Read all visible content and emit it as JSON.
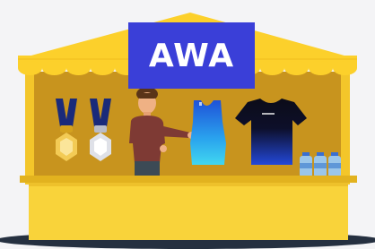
{
  "booth": {
    "sign_text": "AWA",
    "colors": {
      "canopy": "#fcd02b",
      "frame": "#f3c62a",
      "interior": "#c8941e",
      "counter": "#f9d33a",
      "counter_edge": "#e2b21f",
      "sign": "#3a3fd8",
      "shadow": "#253040",
      "background": "#f4f4f6"
    }
  },
  "items": {
    "medals": [
      "gold-medal",
      "silver-medal"
    ],
    "vendor": "vendor-person",
    "jersey": "running-singlet",
    "tshirt": "black-blue-tshirt",
    "bottles_count": 3
  }
}
